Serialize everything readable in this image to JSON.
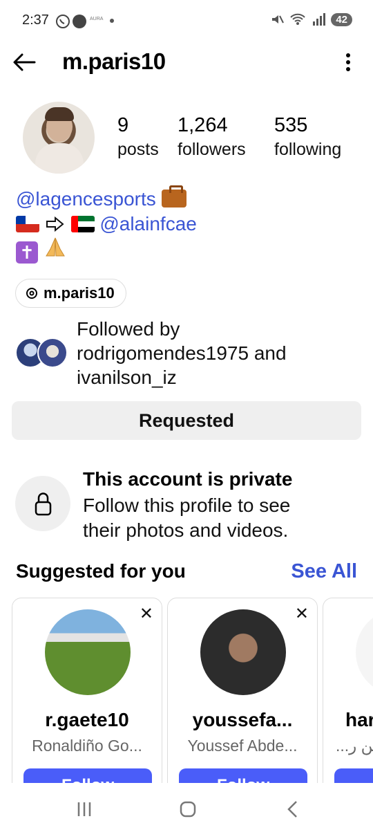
{
  "status_bar": {
    "time": "2:37",
    "battery": "42",
    "aura_label": "AURA"
  },
  "header": {
    "username": "m.paris10"
  },
  "profile": {
    "stats": [
      {
        "value": "9",
        "label": "posts"
      },
      {
        "value": "1,264",
        "label": "followers"
      },
      {
        "value": "535",
        "label": "following"
      }
    ],
    "bio_line1_link": "@lagencesports",
    "bio_line2_link": "@alainfcae",
    "threads_handle": "m.paris10",
    "followed_by_line1": "Followed by",
    "followed_by_line2": "rodrigomendes1975 and",
    "followed_by_line3": "ivanilson_iz",
    "requested_label": "Requested"
  },
  "private_notice": {
    "title": "This account is private",
    "line1": "Follow this profile to see",
    "line2": "their photos and videos."
  },
  "suggested": {
    "heading": "Suggested for you",
    "see_all": "See All",
    "cards": [
      {
        "username": "r.gaete10",
        "name": "Ronaldiño Go...",
        "follow": "Follow"
      },
      {
        "username": "youssefa...",
        "name": "Youssef Abde...",
        "follow": "Follow"
      },
      {
        "username": "har",
        "name": "...بن ر",
        "follow": "Follow"
      }
    ]
  },
  "colors": {
    "link": "#3a55d4",
    "follow_button": "#4a5df9",
    "requested_bg": "#efefef"
  }
}
